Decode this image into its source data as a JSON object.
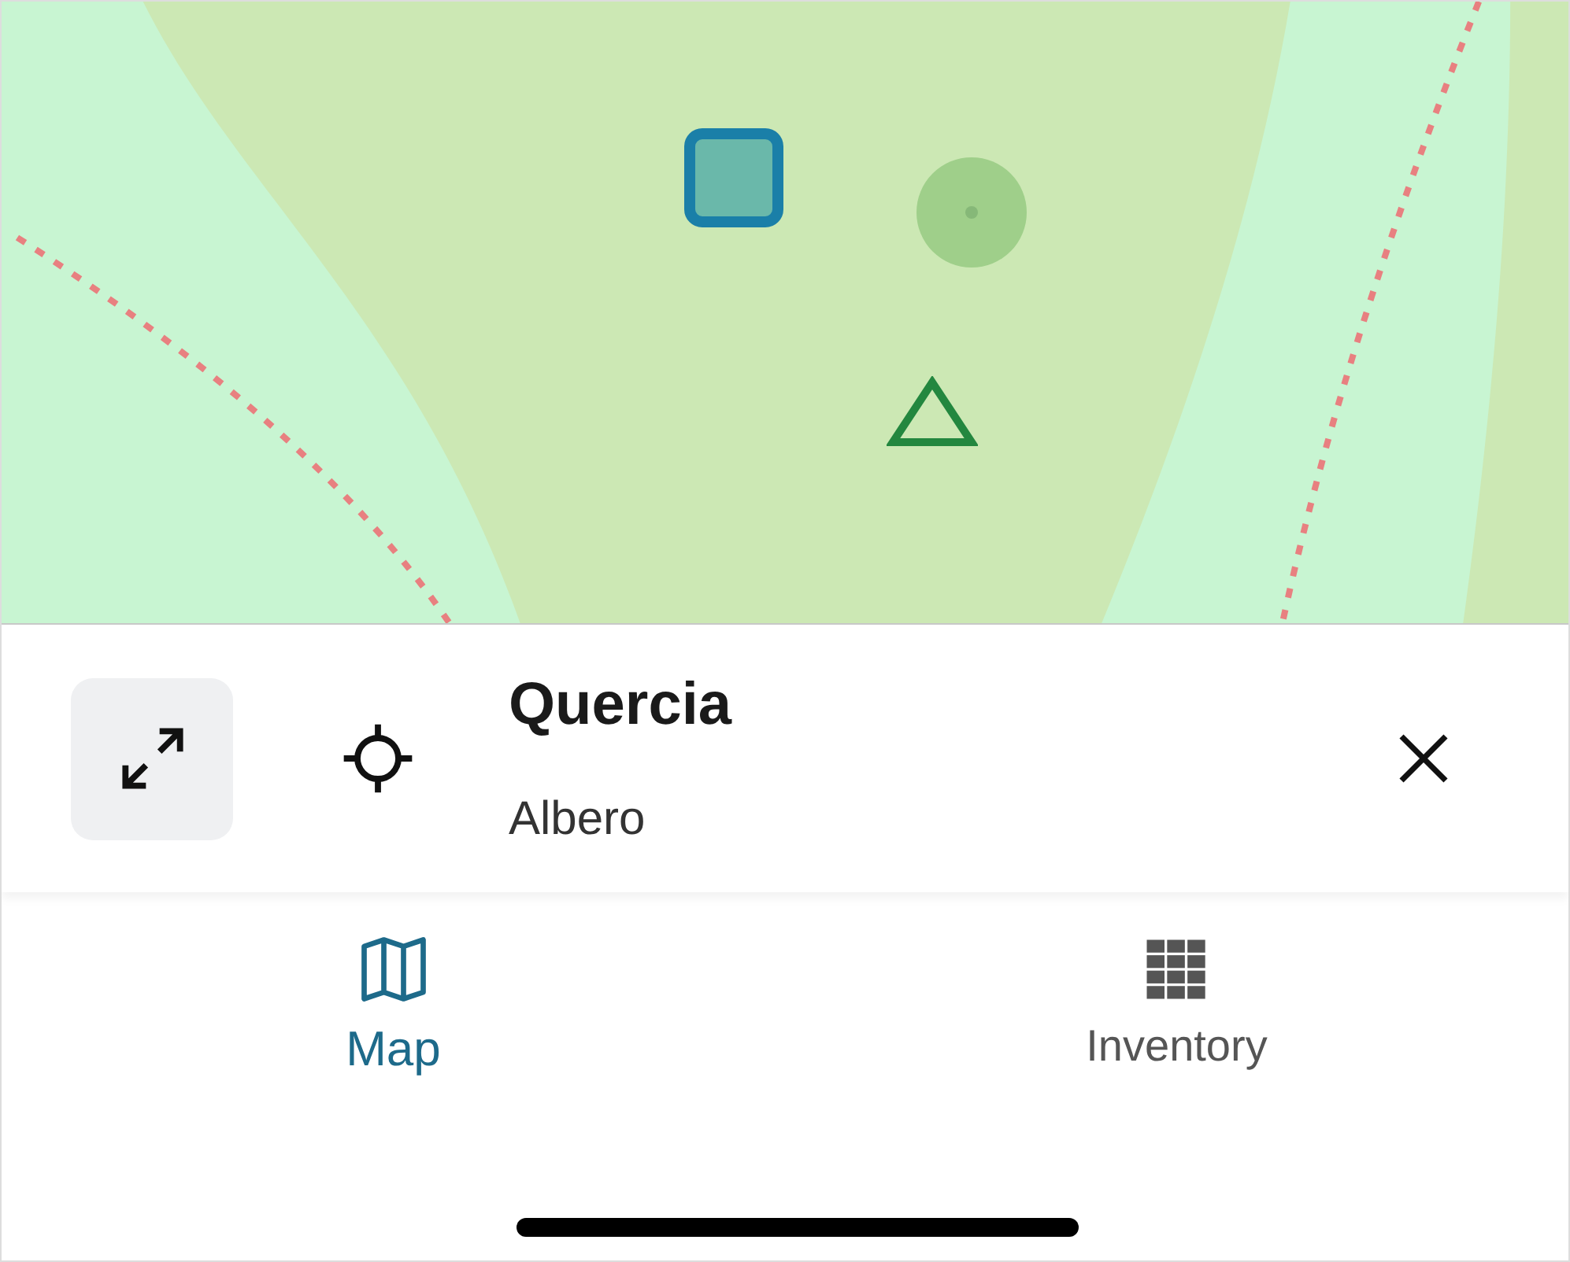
{
  "map": {
    "markers": [
      {
        "kind": "square",
        "color": "#1a7fa8"
      },
      {
        "kind": "dot",
        "color": "#9fcf8a"
      },
      {
        "kind": "triangle",
        "color": "#23873f"
      }
    ]
  },
  "feature": {
    "title": "Quercia",
    "subtitle": "Albero"
  },
  "tabs": [
    {
      "kind": "map",
      "label": "Map",
      "selected": true
    },
    {
      "kind": "table",
      "label": "Inventory",
      "selected": false
    }
  ]
}
